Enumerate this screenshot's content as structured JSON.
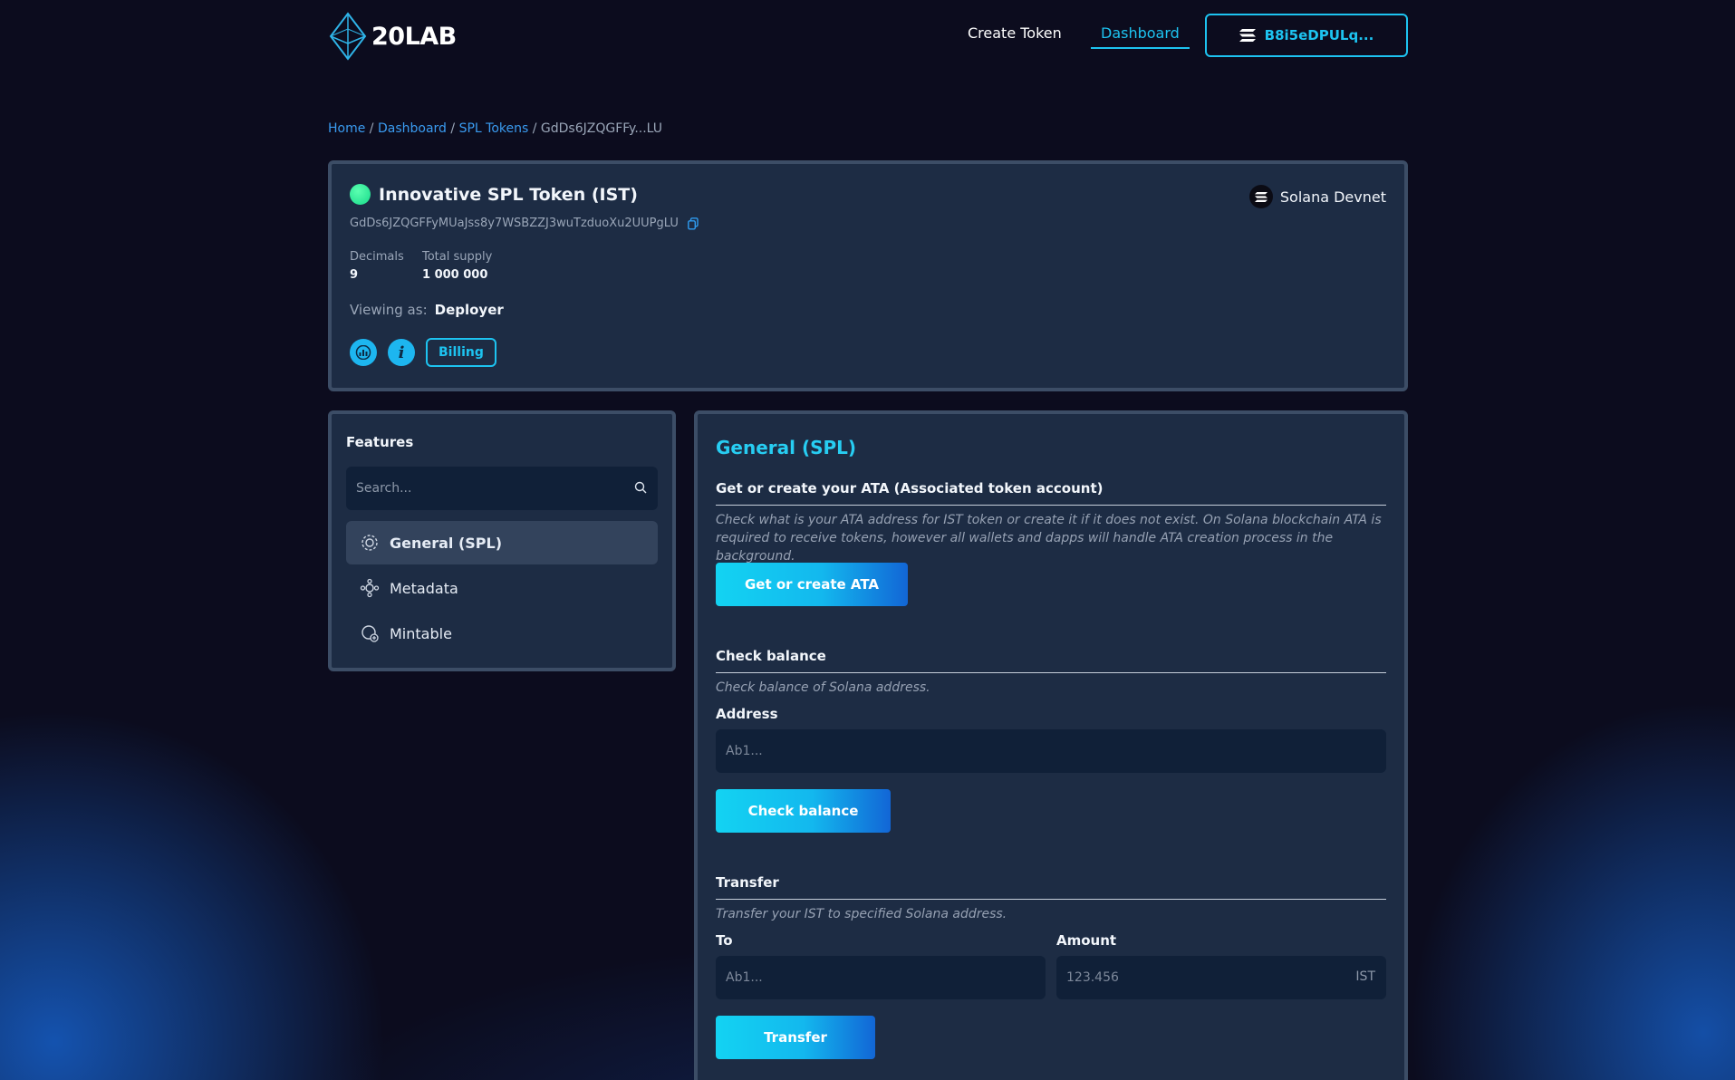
{
  "brand": {
    "name": "20LAB"
  },
  "nav": {
    "create_token": "Create Token",
    "dashboard": "Dashboard",
    "wallet": "B8i5eDPULq..."
  },
  "breadcrumb": {
    "home": "Home",
    "dashboard": "Dashboard",
    "spl_tokens": "SPL Tokens",
    "current": "GdDs6JZQGFFy...LU",
    "separator": " / "
  },
  "token": {
    "name": "Innovative SPL Token (IST)",
    "network": "Solana Devnet",
    "address": "GdDs6JZQGFFyMUaJss8y7WSBZZJ3wuTzduoXu2UUPgLU",
    "decimals_label": "Decimals",
    "decimals": "9",
    "supply_label": "Total supply",
    "supply": "1 000 000",
    "viewing_label": "Viewing as:",
    "viewing_role": "Deployer",
    "billing": "Billing",
    "status_color": "#17d98a"
  },
  "features": {
    "title": "Features",
    "search_placeholder": "Search...",
    "items": [
      {
        "label": "General (SPL)",
        "icon": "gear-coin-icon",
        "active": true
      },
      {
        "label": "Metadata",
        "icon": "metadata-icon",
        "active": false
      },
      {
        "label": "Mintable",
        "icon": "mint-icon",
        "active": false
      }
    ]
  },
  "general": {
    "title": "General (SPL)",
    "ata": {
      "heading": "Get or create your ATA (Associated token account)",
      "desc": "Check what is your ATA address for IST token or create it if it does not exist. On Solana blockchain ATA is required to receive tokens, however all wallets and dapps will handle ATA creation process in the background.",
      "button": "Get or create ATA"
    },
    "balance": {
      "heading": "Check balance",
      "desc": "Check balance of Solana address.",
      "address_label": "Address",
      "address_placeholder": "Ab1...",
      "button": "Check balance"
    },
    "transfer": {
      "heading": "Transfer",
      "desc": "Transfer your IST to specified Solana address.",
      "to_label": "To",
      "to_placeholder": "Ab1...",
      "amount_label": "Amount",
      "amount_placeholder": "123.456",
      "amount_suffix": "IST",
      "button": "Transfer"
    }
  },
  "colors": {
    "accent": "#1dc3f0",
    "panel": "#1d2c44",
    "border": "#3c4d66",
    "bg": "#0c0c1e"
  }
}
